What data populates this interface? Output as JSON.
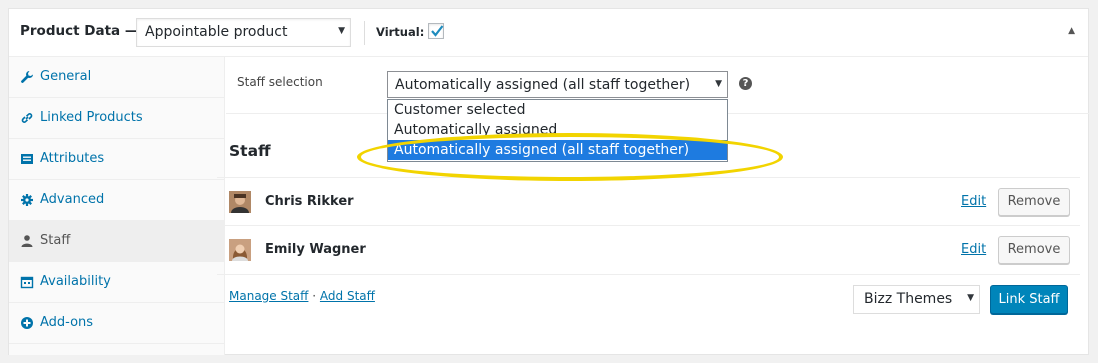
{
  "header": {
    "title": "Product Data —",
    "product_type": "Appointable product",
    "virtual_label": "Virtual:",
    "virtual_checked": true,
    "collapse_icon": "triangle-up-icon"
  },
  "tabs": [
    {
      "label": "General",
      "icon": "wrench-icon"
    },
    {
      "label": "Linked Products",
      "icon": "link-icon"
    },
    {
      "label": "Attributes",
      "icon": "list-icon"
    },
    {
      "label": "Advanced",
      "icon": "gear-icon"
    },
    {
      "label": "Staff",
      "icon": "person-icon",
      "active": true
    },
    {
      "label": "Availability",
      "icon": "calendar-icon"
    },
    {
      "label": "Add-ons",
      "icon": "plus-circle-icon"
    }
  ],
  "staff_selection": {
    "label": "Staff selection",
    "value": "Automatically assigned (all staff together)",
    "help_icon": "question-icon",
    "options": [
      "Customer selected",
      "Automatically assigned",
      "Automatically assigned (all staff together)"
    ],
    "highlight_color": "#f2d400"
  },
  "staff": {
    "heading": "Staff",
    "members": [
      {
        "name": "Chris Rikker",
        "edit": "Edit",
        "remove": "Remove"
      },
      {
        "name": "Emily Wagner",
        "edit": "Edit",
        "remove": "Remove"
      }
    ],
    "manage_link": "Manage Staff",
    "separator": "·",
    "add_link": "Add Staff",
    "staff_select_value": "Bizz Themes",
    "link_button": "Link Staff"
  },
  "colors": {
    "link": "#0073aa",
    "primary_button": "#0085ba",
    "selected_option": "#1e7be0"
  }
}
